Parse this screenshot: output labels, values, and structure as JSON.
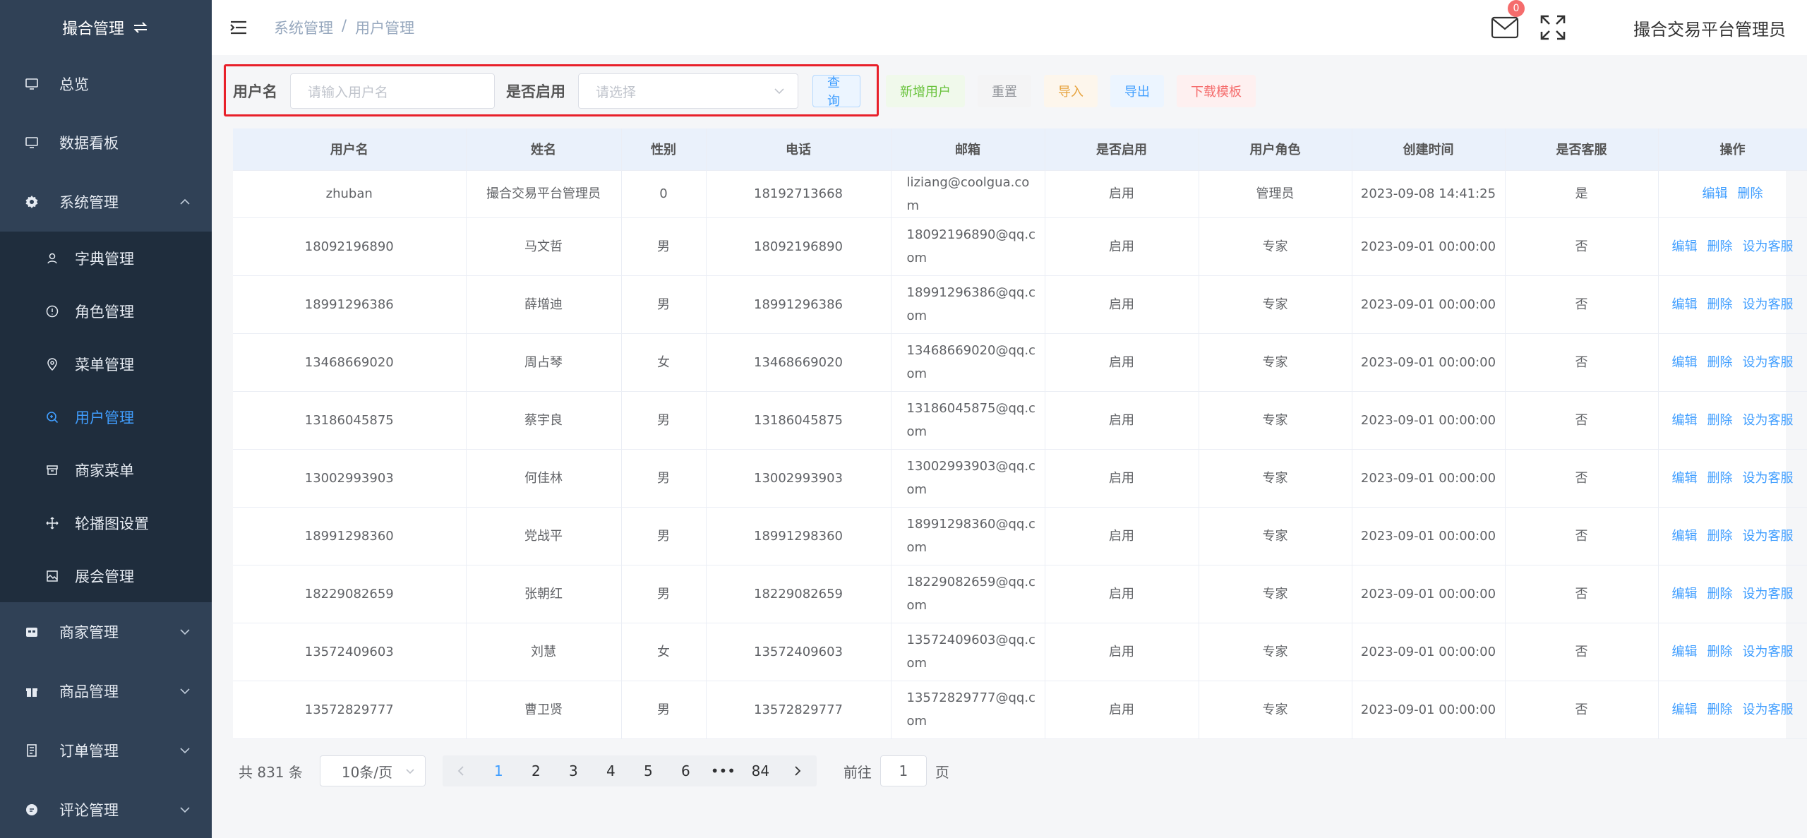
{
  "sidebar": {
    "title": "撮合管理",
    "items": [
      {
        "label": "总览"
      },
      {
        "label": "数据看板"
      },
      {
        "label": "系统管理"
      },
      {
        "label": "商家管理"
      },
      {
        "label": "商品管理"
      },
      {
        "label": "订单管理"
      },
      {
        "label": "评论管理"
      }
    ],
    "subitems": [
      {
        "label": "字典管理"
      },
      {
        "label": "角色管理"
      },
      {
        "label": "菜单管理"
      },
      {
        "label": "用户管理"
      },
      {
        "label": "商家菜单"
      },
      {
        "label": "轮播图设置"
      },
      {
        "label": "展会管理"
      }
    ]
  },
  "header": {
    "breadcrumb": [
      "系统管理",
      "/",
      "用户管理"
    ],
    "badge_count": "0",
    "admin_name": "撮合交易平台管理员"
  },
  "filter": {
    "username_label": "用户名",
    "username_placeholder": "请输入用户名",
    "enabled_label": "是否启用",
    "enabled_placeholder": "请选择",
    "query": "查询",
    "add_user": "新增用户",
    "reset": "重置",
    "import": "导入",
    "export": "导出",
    "download_template": "下载模板"
  },
  "table": {
    "columns": [
      "用户名",
      "姓名",
      "性别",
      "电话",
      "邮箱",
      "是否启用",
      "用户角色",
      "创建时间",
      "是否客服",
      "操作"
    ],
    "rows": [
      {
        "username": "zhuban",
        "name": "撮合交易平台管理员",
        "gender": "0",
        "phone": "18192713668",
        "email": "liziang@coolgua.com",
        "enabled": "启用",
        "role": "管理员",
        "created": "2023-09-08 14:41:25",
        "cs": "是"
      },
      {
        "username": "18092196890",
        "name": "马文哲",
        "gender": "男",
        "phone": "18092196890",
        "email": "18092196890@qq.com",
        "enabled": "启用",
        "role": "专家",
        "created": "2023-09-01 00:00:00",
        "cs": "否"
      },
      {
        "username": "18991296386",
        "name": "薛增迪",
        "gender": "男",
        "phone": "18991296386",
        "email": "18991296386@qq.com",
        "enabled": "启用",
        "role": "专家",
        "created": "2023-09-01 00:00:00",
        "cs": "否"
      },
      {
        "username": "13468669020",
        "name": "周占琴",
        "gender": "女",
        "phone": "13468669020",
        "email": "13468669020@qq.com",
        "enabled": "启用",
        "role": "专家",
        "created": "2023-09-01 00:00:00",
        "cs": "否"
      },
      {
        "username": "13186045875",
        "name": "蔡宇良",
        "gender": "男",
        "phone": "13186045875",
        "email": "13186045875@qq.com",
        "enabled": "启用",
        "role": "专家",
        "created": "2023-09-01 00:00:00",
        "cs": "否"
      },
      {
        "username": "13002993903",
        "name": "何佳林",
        "gender": "男",
        "phone": "13002993903",
        "email": "13002993903@qq.com",
        "enabled": "启用",
        "role": "专家",
        "created": "2023-09-01 00:00:00",
        "cs": "否"
      },
      {
        "username": "18991298360",
        "name": "党战平",
        "gender": "男",
        "phone": "18991298360",
        "email": "18991298360@qq.com",
        "enabled": "启用",
        "role": "专家",
        "created": "2023-09-01 00:00:00",
        "cs": "否"
      },
      {
        "username": "18229082659",
        "name": "张朝红",
        "gender": "男",
        "phone": "18229082659",
        "email": "18229082659@qq.com",
        "enabled": "启用",
        "role": "专家",
        "created": "2023-09-01 00:00:00",
        "cs": "否"
      },
      {
        "username": "13572409603",
        "name": "刘慧",
        "gender": "女",
        "phone": "13572409603",
        "email": "13572409603@qq.com",
        "enabled": "启用",
        "role": "专家",
        "created": "2023-09-01 00:00:00",
        "cs": "否"
      },
      {
        "username": "13572829777",
        "name": "曹卫贤",
        "gender": "男",
        "phone": "13572829777",
        "email": "13572829777@qq.com",
        "enabled": "启用",
        "role": "专家",
        "created": "2023-09-01 00:00:00",
        "cs": "否"
      }
    ],
    "actions": {
      "edit": "编辑",
      "delete": "删除",
      "set_cs": "设为客服"
    }
  },
  "pagination": {
    "total": "共 831 条",
    "page_size": "10条/页",
    "pages": [
      "1",
      "2",
      "3",
      "4",
      "5",
      "6",
      "•••",
      "84"
    ],
    "current_page": "1",
    "goto_label": "前往",
    "goto_value": "1",
    "goto_suffix": "页"
  },
  "colors": {
    "sidebar_bg": "#304156",
    "submenu_bg": "#1f2d3d",
    "primary": "#409eff",
    "highlight_border": "#e8202a"
  },
  "icons": [
    "switch-icon",
    "monitor-icon",
    "gear-icon",
    "user-icon",
    "info-icon",
    "location-icon",
    "search-icon",
    "archive-icon",
    "move-icon",
    "image-icon",
    "shop-icon",
    "gift-icon",
    "document-icon",
    "comment-icon",
    "hamburger-icon",
    "mail-icon",
    "fullscreen-icon",
    "chevron-down-icon",
    "chevron-left-icon",
    "chevron-right-icon"
  ]
}
